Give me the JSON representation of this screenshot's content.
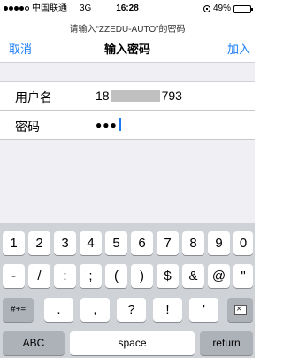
{
  "status_bar": {
    "carrier": "中国联通",
    "network": "3G",
    "time": "16:28",
    "battery": "49%",
    "battery_level": 0.49,
    "signal_bars": 5,
    "signal_filled": 4
  },
  "dialog": {
    "subtitle": "请输入“ZZEDU-AUTO”的密码",
    "title": "输入密码",
    "cancel_label": "取消",
    "join_label": "加入"
  },
  "form": {
    "username_label": "用户名",
    "username_prefix": "18",
    "username_suffix": "793",
    "password_label": "密码",
    "password_value": "●●●"
  },
  "keyboard": {
    "row1": [
      "1",
      "2",
      "3",
      "4",
      "5",
      "6",
      "7",
      "8",
      "9",
      "0"
    ],
    "row2": [
      "-",
      "/",
      ":",
      ";",
      "(",
      ")",
      "$",
      "&",
      "@",
      "\""
    ],
    "row3_mode": "#+=",
    "row3": [
      ".",
      ",",
      "?",
      "!",
      "'"
    ],
    "row4_mode": "ABC",
    "space": "space",
    "return": "return"
  },
  "colors": {
    "accent": "#1a7cf5",
    "keyboard_bg": "#cfd2d6",
    "group_bg": "#efeff4"
  }
}
